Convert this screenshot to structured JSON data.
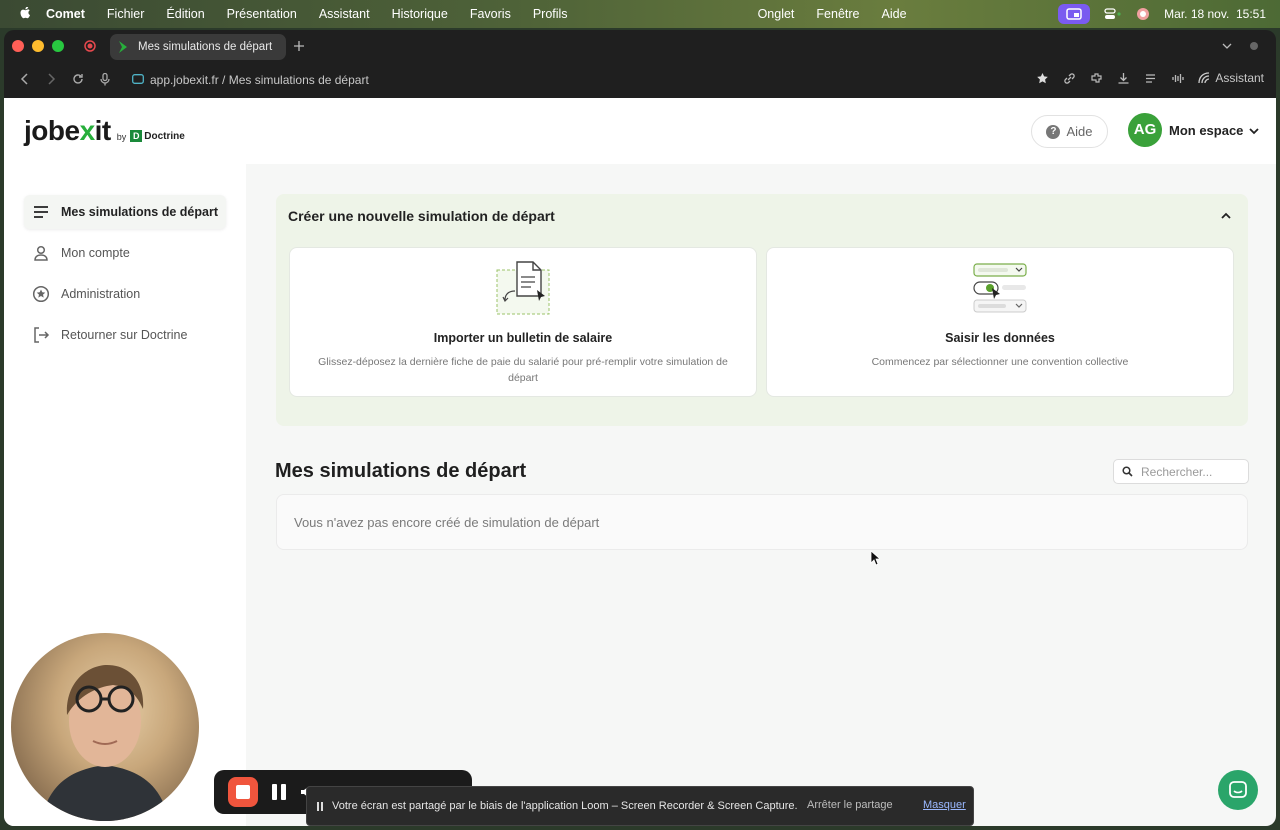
{
  "menubar": {
    "app_name": "Comet",
    "items": [
      "Fichier",
      "Édition",
      "Présentation",
      "Assistant",
      "Historique",
      "Favoris",
      "Profils",
      "Onglet",
      "Fenêtre",
      "Aide"
    ],
    "datetime": "Mar. 18 nov.  15:51"
  },
  "browser": {
    "tab_title": "Mes simulations de départ",
    "url": "app.jobexit.fr / Mes simulations de départ",
    "assistant_label": "Assistant"
  },
  "header": {
    "logo_main": "jobe",
    "logo_x": "x",
    "logo_end": "it",
    "logo_by": "by",
    "logo_doctrine_mark": "D",
    "logo_doctrine": "Doctrine",
    "help_icon": "?",
    "help_label": "Aide",
    "avatar_initials": "AG",
    "space_label": "Mon espace"
  },
  "sidebar": {
    "items": [
      {
        "label": "Mes simulations de départ",
        "icon": "menu-icon"
      },
      {
        "label": "Mon compte",
        "icon": "user-icon"
      },
      {
        "label": "Administration",
        "icon": "star-icon"
      },
      {
        "label": "Retourner sur Doctrine",
        "icon": "logout-icon"
      }
    ]
  },
  "create": {
    "title": "Créer une nouvelle simulation de départ",
    "cards": [
      {
        "title": "Importer un bulletin de salaire",
        "desc": "Glissez-déposez la dernière fiche de paie du salarié pour pré-remplir votre simulation de départ"
      },
      {
        "title": "Saisir les données",
        "desc": "Commencez par sélectionner une convention collective"
      }
    ]
  },
  "list": {
    "title": "Mes simulations de départ",
    "search_placeholder": "Rechercher...",
    "empty_text": "Vous n'avez pas encore créé de simulation de départ"
  },
  "loom": {
    "share_text": "Votre écran est partagé par le biais de l'application Loom – Screen Recorder & Screen Capture.",
    "stop_label": "Arrêter le partage",
    "hide_label": "Masquer"
  },
  "colors": {
    "brand_green": "#27ae3b",
    "panel_green": "#eef4e8",
    "record_red": "#f0553d",
    "chat_green": "#2aa56a"
  }
}
